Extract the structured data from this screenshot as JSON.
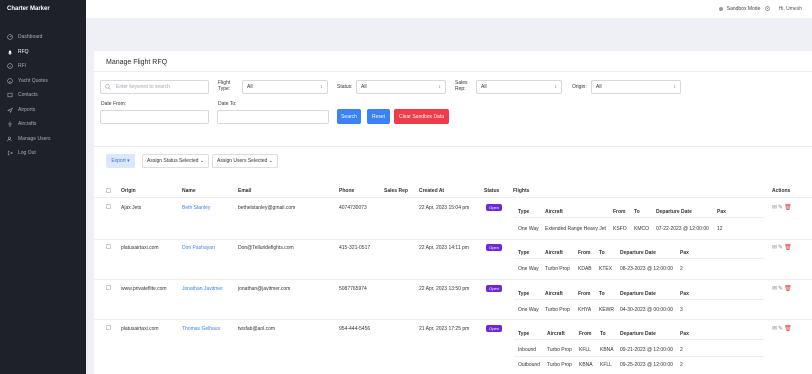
{
  "app": {
    "brand": "Charter Marker"
  },
  "sidebar": {
    "items": [
      {
        "label": "Dashboard",
        "icon": "dashboard-icon"
      },
      {
        "label": "RFQ",
        "icon": "bell-icon"
      },
      {
        "label": "RFI",
        "icon": "info-icon"
      },
      {
        "label": "Yacht Quotes",
        "icon": "yacht-icon"
      },
      {
        "label": "Contacts",
        "icon": "contacts-icon"
      },
      {
        "label": "Airports",
        "icon": "plane-icon"
      },
      {
        "label": "Aircrafts",
        "icon": "aircraft-icon"
      },
      {
        "label": "Manage Users",
        "icon": "users-icon"
      },
      {
        "label": "Log Out",
        "icon": "logout-icon"
      }
    ]
  },
  "topbar": {
    "sandbox_label": "Sandbox Mode",
    "greeting": "Hi, Umesh"
  },
  "page": {
    "title": "Manage Flight RFQ"
  },
  "filters": {
    "search_placeholder": "Enter keyword to search",
    "flight_type_label": "Flight Type:",
    "flight_type_value": "All",
    "status_label": "Status:",
    "status_value": "All",
    "sales_rep_label": "Sales Rep:",
    "sales_rep_value": "All",
    "origin_label": "Origin:",
    "origin_value": "All",
    "date_from_label": "Date From:",
    "date_to_label": "Date To:",
    "search_button": "Search",
    "reset_button": "Reset",
    "clear_sandbox_button": "Clear Sandbox Data"
  },
  "toolbar": {
    "export": "Export ▾",
    "assign_status": "Assign Status Selected ⌄",
    "assign_users": "Assign Users Selected ⌄"
  },
  "table": {
    "headers": {
      "origin": "Origin",
      "name": "Name",
      "email": "Email",
      "phone": "Phone",
      "sales_rep": "Sales Rep",
      "created": "Created At",
      "status": "Status",
      "flights": "Flights",
      "actions": "Actions"
    },
    "flight_headers": [
      "Type",
      "Aircraft",
      "From",
      "To",
      "Departure Date",
      "Pax"
    ],
    "rows": [
      {
        "origin": "Ajax Jets",
        "name": "Beth Stanley",
        "email": "bethelstanley@gmail.com",
        "phone": "4074730073",
        "created": "22 Apr, 2023 15:04 pm",
        "status": "Open",
        "flights": [
          {
            "type": "One Way",
            "aircraft": "Extended Range Heavy Jet",
            "from": "KSFO",
            "to": "KMCO",
            "date": "07-22-2023 @ 12:00:00",
            "pax": "12"
          }
        ]
      },
      {
        "origin": "platusairtaxi.com",
        "name": "Don Pashayan",
        "email": "Don@Telluridefights.com",
        "phone": "415-321-0517",
        "created": "22 Apr, 2023 14:11 pm",
        "status": "Open",
        "flights": [
          {
            "type": "One Way",
            "aircraft": "Turbo Prop",
            "from": "KDAB",
            "to": "KTEX",
            "date": "08-23-2023 @ 12:00:00",
            "pax": "2"
          }
        ]
      },
      {
        "origin": "www.privateflite.com",
        "name": "Jonathan Javitmer",
        "email": "jonathan@javitmer.com",
        "phone": "5087765974",
        "created": "22 Apr, 2023 13:50 pm",
        "status": "Open",
        "flights": [
          {
            "type": "One Way",
            "aircraft": "Turbo Prop",
            "from": "KHYA",
            "to": "KEWR",
            "date": "04-30-2023 @ 00:00:00",
            "pax": "3"
          }
        ]
      },
      {
        "origin": "platusairtaxi.com",
        "name": "Thomas Gelhaus",
        "email": "twsfab@aol.com",
        "phone": "954-444-5456",
        "created": "21 Apr, 2023 17:25 pm",
        "status": "Open",
        "flights": [
          {
            "type": "Inbound",
            "aircraft": "Turbo Prop",
            "from": "KFLL",
            "to": "KBNA",
            "date": "09-21-2023 @ 12:00:00",
            "pax": "2"
          },
          {
            "type": "Outbound",
            "aircraft": "Turbo Prop",
            "from": "KBNA",
            "to": "KFLL",
            "date": "09-25-2023 @ 12:00:00",
            "pax": "2"
          }
        ]
      }
    ]
  },
  "colors": {
    "sidebar_bg": "#1f2129",
    "primary": "#3b82f6",
    "danger": "#ef3b4a",
    "status_open": "#6d28d9"
  }
}
